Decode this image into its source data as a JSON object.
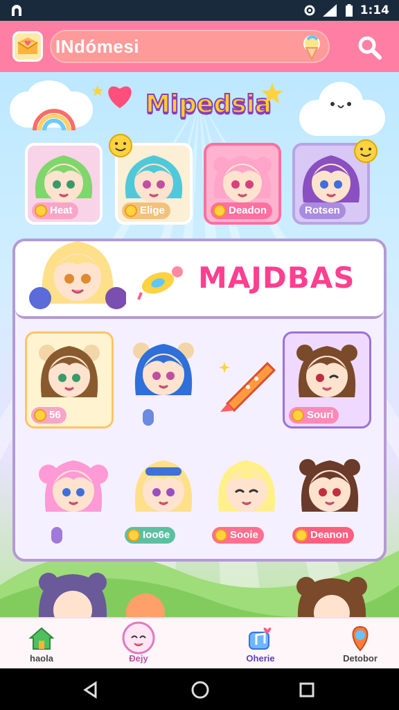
{
  "status_bar": {
    "time": "1:14"
  },
  "header": {
    "search_text": "INdómesi"
  },
  "scene": {
    "logo_title": "Mipedsia"
  },
  "top_characters": [
    {
      "tag": "Heat",
      "color": "#f7a6c8"
    },
    {
      "tag": "Elige",
      "color": "#f1c27d"
    },
    {
      "tag": "Deadon",
      "color": "#ff6f9f"
    },
    {
      "tag": "Rotsen",
      "color": "#a98be0"
    }
  ],
  "banner": {
    "title": "MAJDBAS"
  },
  "grid_characters": [
    {
      "tag": "56 ",
      "framed": "gold"
    },
    {
      "tag": ""
    },
    {
      "tag": ""
    },
    {
      "tag": "Souri",
      "framed": "purple"
    },
    {
      "tag": ""
    },
    {
      "tag": "Ioo6e"
    },
    {
      "tag": "Sooie"
    },
    {
      "tag": "Deanon"
    }
  ],
  "bottom_nav": [
    {
      "label": "haola",
      "icon": "home-icon"
    },
    {
      "label": "Ðejy",
      "icon": "mascot-icon"
    },
    {
      "label": "Oherie",
      "icon": "music-icon"
    },
    {
      "label": "Detobor",
      "icon": "profile-icon"
    }
  ],
  "colors": {
    "topbar": "#ff7fa4",
    "accent_pink": "#ff3f8f",
    "panel_border": "#b49ad6"
  }
}
